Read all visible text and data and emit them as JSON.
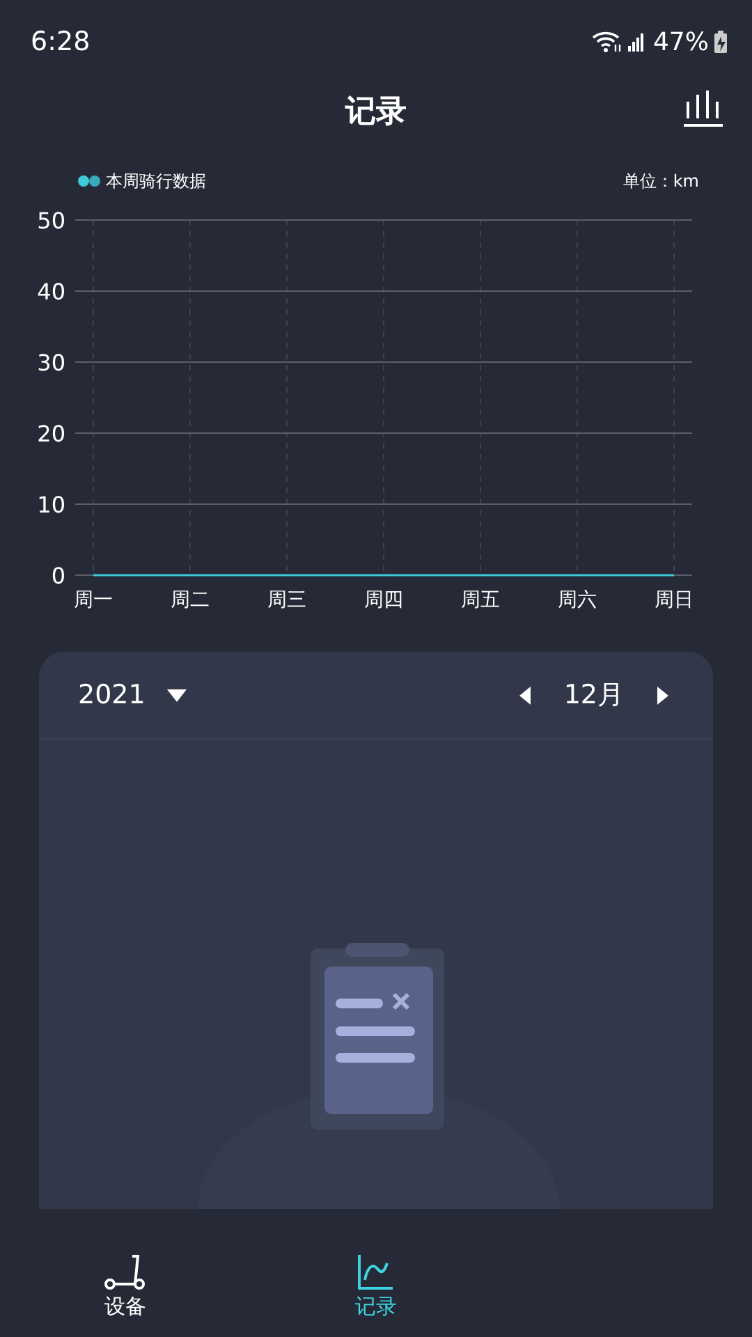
{
  "status_bar": {
    "time": "6:28",
    "battery": "47%"
  },
  "header": {
    "title": "记录"
  },
  "chart": {
    "unit": "单位：km",
    "chart_data": {
      "type": "line",
      "categories": [
        "周一",
        "周二",
        "周三",
        "周四",
        "周五",
        "周六",
        "周日"
      ],
      "series": [
        {
          "name": "本周骑行数据",
          "color": "#3fc8d8",
          "values": [
            0,
            0,
            0,
            0,
            0,
            0,
            0
          ]
        }
      ],
      "grid": true,
      "ylim": [
        0,
        50
      ],
      "yticks": [
        0,
        10,
        20,
        30,
        40,
        50
      ]
    }
  },
  "calendar": {
    "year": "2021",
    "month": "12月"
  },
  "nav": [
    {
      "label": "设备",
      "kind": "scooter",
      "selected": false
    },
    {
      "label": "记录",
      "kind": "chart",
      "selected": true
    }
  ]
}
